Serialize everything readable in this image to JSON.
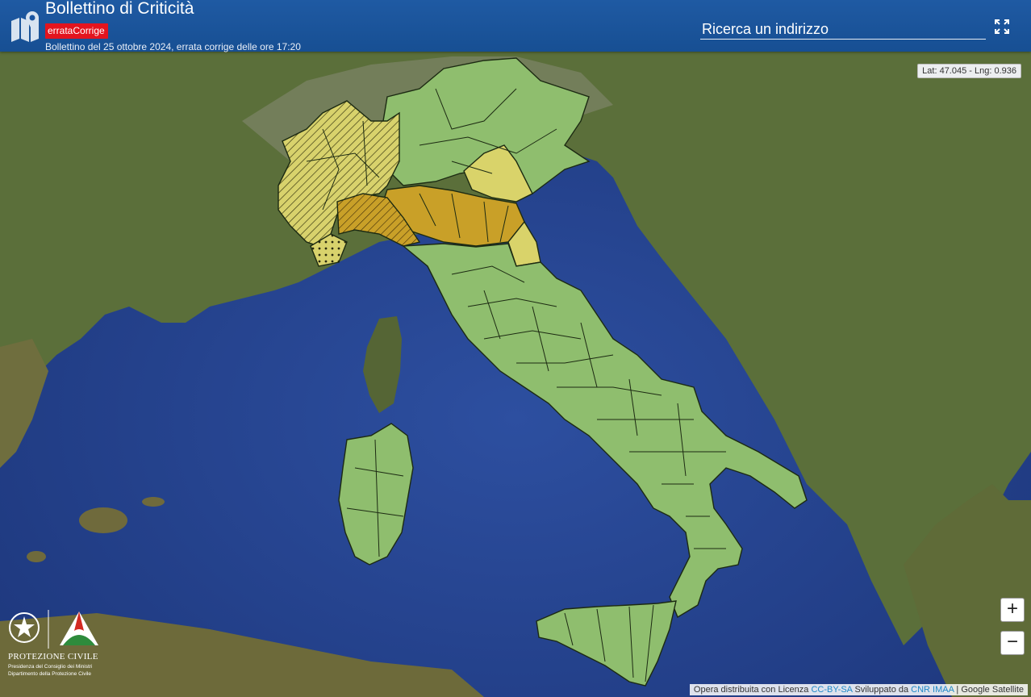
{
  "header": {
    "title": "Bollettino di Criticità",
    "badge": "errataCorrige",
    "subtitle": "Bollettino del 25 ottobre 2024, errata corrige delle ore 17:20"
  },
  "search": {
    "placeholder": "Ricerca un indirizzo"
  },
  "coords": "Lat: 47.045 - Lng: 0.936",
  "zoom": {
    "in": "+",
    "out": "−"
  },
  "logo": {
    "line1": "PROTEZIONE CIVILE",
    "line2": "Presidenza del Consiglio dei Ministri",
    "line3": "Dipartimento della Protezione Civile"
  },
  "attribution": {
    "prefix": "Opera distribuita con Licenza ",
    "license": "CC-BY-SA",
    "developed": " Sviluppato da ",
    "developer": "CNR IMAA",
    "provider": " | Google Satellite"
  },
  "colors": {
    "green": "#8fbe6e",
    "yellow": "#d9d36a",
    "orange": "#c9a028",
    "badge": "#e3141e",
    "header": "#1a54a0"
  },
  "icons": [
    "map-pin-icon",
    "fullscreen-icon",
    "emblem-icon",
    "civil-protection-icon"
  ]
}
